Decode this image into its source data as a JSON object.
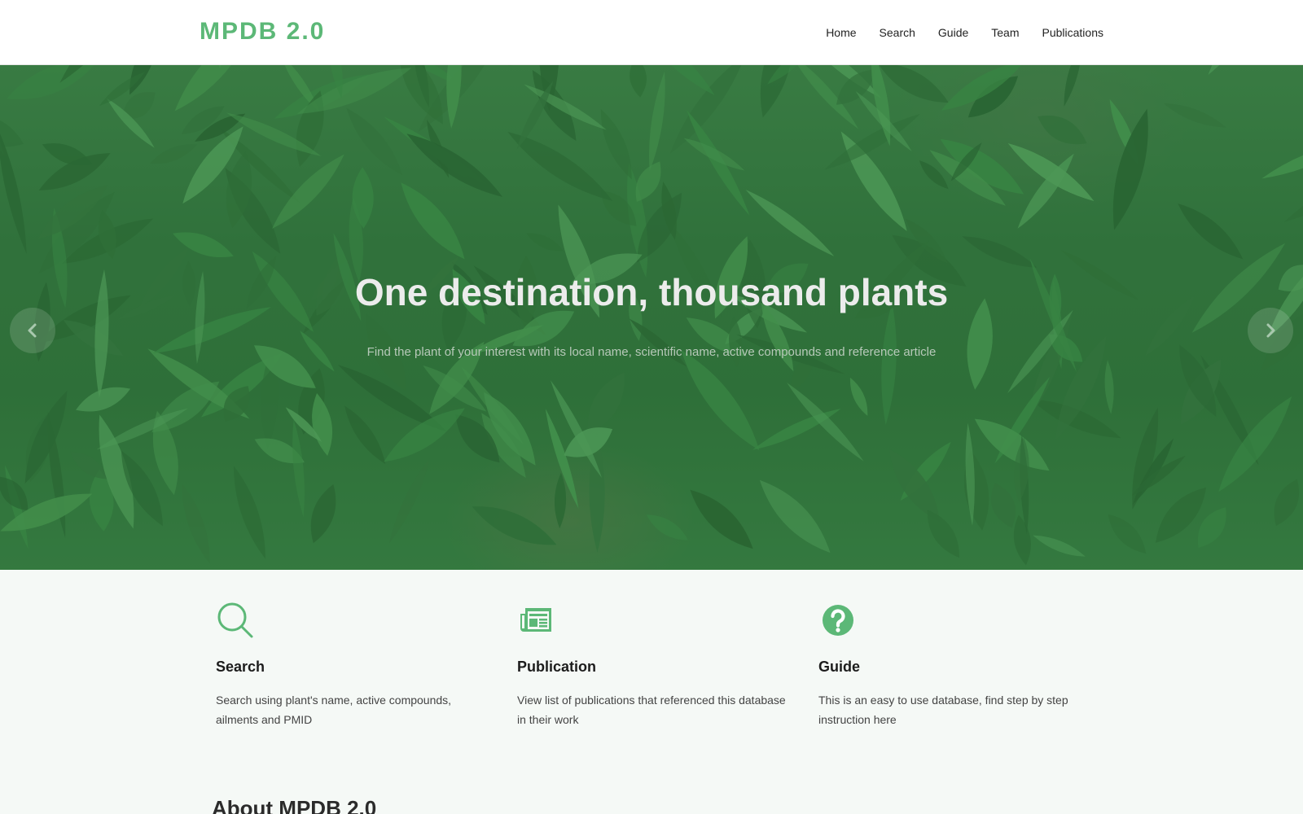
{
  "brand": "MPDB 2.0",
  "nav": [
    "Home",
    "Search",
    "Guide",
    "Team",
    "Publications"
  ],
  "hero": {
    "title": "One destination, thousand plants",
    "subtitle": "Find the plant of your interest with its local name, scientific name, active compounds and reference article"
  },
  "features": [
    {
      "icon": "search-icon",
      "title": "Search",
      "text": "Search using plant's name, active compounds, ailments and PMID"
    },
    {
      "icon": "newspaper-icon",
      "title": "Publication",
      "text": "View list of publications that referenced this database in their work"
    },
    {
      "icon": "question-circle-icon",
      "title": "Guide",
      "text": "This is an easy to use database, find step by step instruction here"
    }
  ],
  "about_heading": "About MPDB 2.0",
  "colors": {
    "accent": "#5cb877",
    "hero_green": "#2f6e3a"
  }
}
